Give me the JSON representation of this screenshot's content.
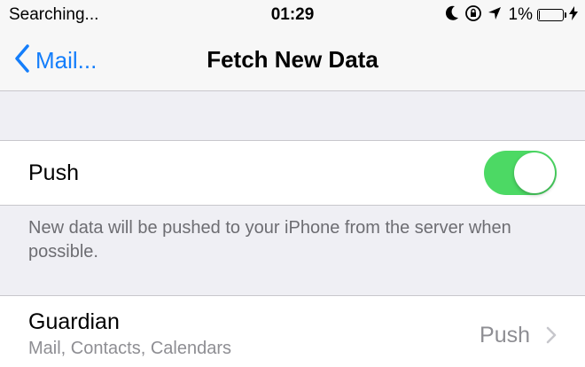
{
  "status_bar": {
    "carrier": "Searching...",
    "time": "01:29",
    "battery_percent": "1%",
    "battery_level": 0.01,
    "icons": [
      "moon-icon",
      "orientation-lock-icon",
      "location-arrow-icon",
      "battery-icon",
      "charging-bolt-icon"
    ]
  },
  "nav": {
    "back_label": "Mail...",
    "title": "Fetch New Data"
  },
  "push_setting": {
    "label": "Push",
    "enabled": true,
    "toggle_color": "#4cd964",
    "footnote": "New data will be pushed to your iPhone from the server when possible."
  },
  "accounts": [
    {
      "name": "Guardian",
      "services": "Mail, Contacts, Calendars",
      "value": "Push"
    }
  ],
  "colors": {
    "accent": "#147efb",
    "background": "#efeff4",
    "secondary_text": "#8e8e93"
  }
}
